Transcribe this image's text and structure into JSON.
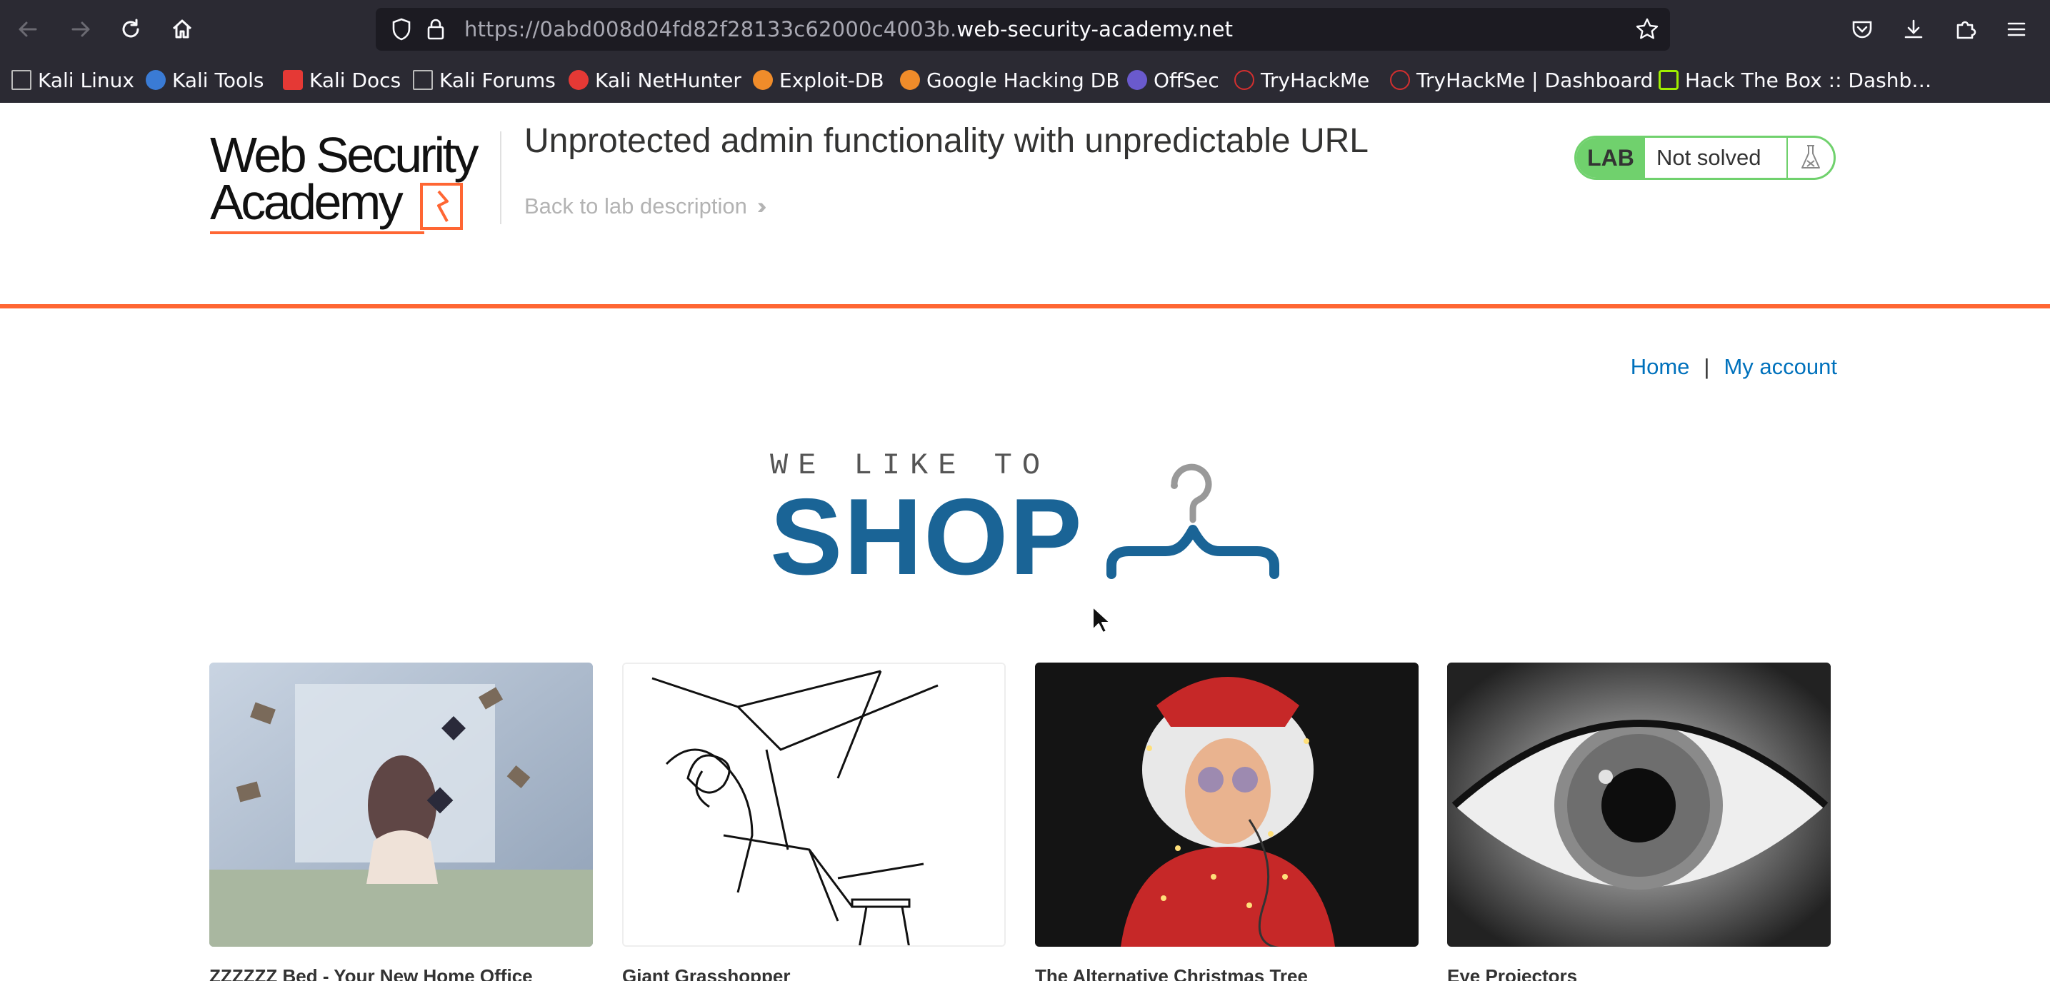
{
  "browser": {
    "url_prefix": "https://0abd008d04fd82f28133c62000c4003b.",
    "url_domain": "web-security-academy.net"
  },
  "bookmarks": [
    {
      "label": "Kali Linux",
      "icon": "kali-dragon-icon",
      "color": "#cccccc"
    },
    {
      "label": "Kali Tools",
      "icon": "kali-tools-icon",
      "color": "#3a7bd5"
    },
    {
      "label": "Kali Docs",
      "icon": "kali-docs-icon",
      "color": "#e53935"
    },
    {
      "label": "Kali Forums",
      "icon": "kali-forums-icon",
      "color": "#cccccc"
    },
    {
      "label": "Kali NetHunter",
      "icon": "nethunter-icon",
      "color": "#e53935"
    },
    {
      "label": "Exploit-DB",
      "icon": "exploit-db-icon",
      "color": "#f08c2a"
    },
    {
      "label": "Google Hacking DB",
      "icon": "ghdb-icon",
      "color": "#f08c2a"
    },
    {
      "label": "OffSec",
      "icon": "offsec-icon",
      "color": "#6a5acd"
    },
    {
      "label": "TryHackMe",
      "icon": "tryhackme-icon",
      "color": "#d32f2f"
    },
    {
      "label": "TryHackMe | Dashboard",
      "icon": "tryhackme-icon",
      "color": "#d32f2f"
    },
    {
      "label": "Hack The Box :: Dashb…",
      "icon": "hackthebox-icon",
      "color": "#9fef00"
    }
  ],
  "header": {
    "logo_line1": "Web Security",
    "logo_line2": "Academy",
    "lab_title": "Unprotected admin functionality with unpredictable URL",
    "back_link": "Back to lab description",
    "lab_badge": "LAB",
    "lab_status": "Not solved",
    "accent_color": "#ff6633",
    "status_color": "#70d16d"
  },
  "nav": {
    "home": "Home",
    "separator": "|",
    "account": "My account"
  },
  "banner": {
    "small_text": "WE LIKE TO",
    "big_text": "SHOP"
  },
  "products": [
    {
      "name": "ZZZZZZ Bed - Your New Home Office"
    },
    {
      "name": "Giant Grasshopper"
    },
    {
      "name": "The Alternative Christmas Tree"
    },
    {
      "name": "Eye Projectors"
    }
  ]
}
